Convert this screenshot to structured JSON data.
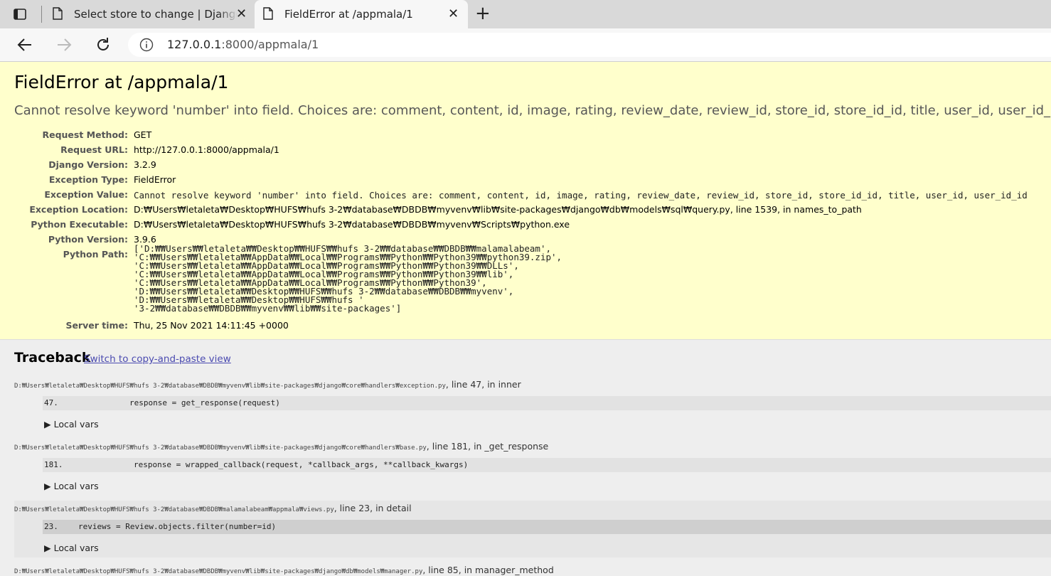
{
  "browser": {
    "tabs": [
      {
        "label": "Select store to change | Django site admin",
        "close": "✕"
      },
      {
        "label": "FieldError at /appmala/1",
        "close": "✕"
      }
    ],
    "new_tab": "+",
    "url_host": "127.0.0.1",
    "url_path": ":8000/appmala/1"
  },
  "summary": {
    "title": "FieldError at /appmala/1",
    "message": "Cannot resolve keyword 'number' into field. Choices are: comment, content, id, image, rating, review_date, review_id, store_id, store_id_id, title, user_id, user_id_id",
    "meta": [
      {
        "key": "Request Method:",
        "value": "GET"
      },
      {
        "key": "Request URL:",
        "value": "http://127.0.0.1:8000/appmala/1"
      },
      {
        "key": "Django Version:",
        "value": "3.2.9"
      },
      {
        "key": "Exception Type:",
        "value": "FieldError"
      },
      {
        "key": "Exception Value:",
        "value": "Cannot resolve keyword 'number' into field. Choices are: comment, content, id, image, rating, review_date, review_id, store_id, store_id_id, title, user_id, user_id_id"
      },
      {
        "key": "Exception Location:",
        "value": "D:₩Users₩letaleta₩Desktop₩HUFS₩hufs 3-2₩database₩DBDB₩myvenv₩lib₩site-packages₩django₩db₩models₩sql₩query.py, line 1539, in names_to_path"
      },
      {
        "key": "Python Executable:",
        "value": "D:₩Users₩letaleta₩Desktop₩HUFS₩hufs 3-2₩database₩DBDB₩myvenv₩Scripts₩python.exe"
      },
      {
        "key": "Python Version:",
        "value": "3.9.6"
      },
      {
        "key": "Python Path:",
        "value": [
          "['D:₩₩Users₩₩letaleta₩₩Desktop₩₩HUFS₩₩hufs 3-2₩₩database₩₩DBDB₩₩malamalabeam',",
          " 'C:₩₩Users₩₩letaleta₩₩AppData₩₩Local₩₩Programs₩₩Python₩₩Python39₩₩python39.zip',",
          " 'C:₩₩Users₩₩letaleta₩₩AppData₩₩Local₩₩Programs₩₩Python₩₩Python39₩₩DLLs',",
          " 'C:₩₩Users₩₩letaleta₩₩AppData₩₩Local₩₩Programs₩₩Python₩₩Python39₩₩lib',",
          " 'C:₩₩Users₩₩letaleta₩₩AppData₩₩Local₩₩Programs₩₩Python₩₩Python39',",
          " 'D:₩₩Users₩₩letaleta₩₩Desktop₩₩HUFS₩₩hufs 3-2₩₩database₩₩DBDB₩₩myvenv',",
          " 'D:₩₩Users₩₩letaleta₩₩Desktop₩₩HUFS₩₩hufs '",
          " '3-2₩₩database₩₩DBDB₩₩myvenv₩₩lib₩₩site-packages']"
        ]
      },
      {
        "key": "Server time:",
        "value": "Thu, 25 Nov 2021 14:11:45 +0000"
      }
    ]
  },
  "traceback": {
    "title": "Traceback",
    "switch_link": "Switch to copy-and-paste view",
    "local_vars_label": "Local vars",
    "frames": [
      {
        "file": "D:₩Users₩letaleta₩Desktop₩HUFS₩hufs 3-2₩database₩DBDB₩myvenv₩lib₩site-packages₩django₩core₩handlers₩exception.py",
        "where": ", line 47, in inner",
        "line_no": "47.",
        "code": "response = get_response(request)"
      },
      {
        "file": "D:₩Users₩letaleta₩Desktop₩HUFS₩hufs 3-2₩database₩DBDB₩myvenv₩lib₩site-packages₩django₩core₩handlers₩base.py",
        "where": ", line 181, in _get_response",
        "line_no": "181.",
        "code": "response = wrapped_callback(request, *callback_args, **callback_kwargs)"
      },
      {
        "file": "D:₩Users₩letaleta₩Desktop₩HUFS₩hufs 3-2₩database₩DBDB₩malamalabeam₩appmala₩views.py",
        "where": ", line 23, in detail",
        "line_no": "23.",
        "code": "reviews = Review.objects.filter(number=id)"
      },
      {
        "file": "D:₩Users₩letaleta₩Desktop₩HUFS₩hufs 3-2₩database₩DBDB₩myvenv₩lib₩site-packages₩django₩db₩models₩manager.py",
        "where": ", line 85, in manager_method"
      }
    ]
  },
  "colors": {
    "summary_bg": "#ffffcc",
    "traceback_bg": "#eeeeee",
    "link": "#4a4ab0"
  },
  "icons": [
    "tab-actions-icon",
    "document-icon",
    "close-icon",
    "new-tab-icon",
    "back-arrow-icon",
    "forward-arrow-icon",
    "reload-icon",
    "info-icon",
    "triangle-right-icon"
  ]
}
